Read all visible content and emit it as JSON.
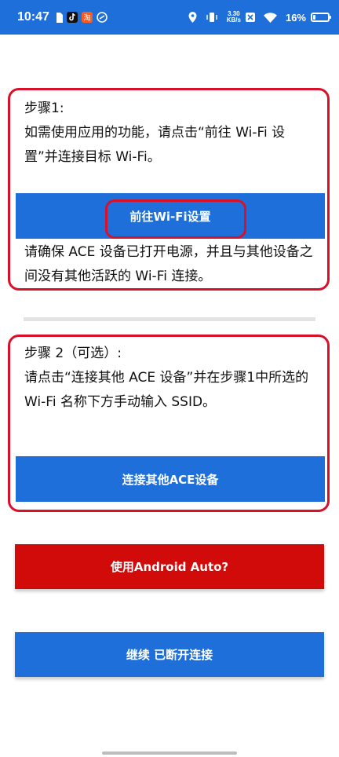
{
  "status_bar": {
    "time": "10:47",
    "net_speed_value": "3.30",
    "net_speed_unit": "KB/s",
    "battery_percent": "16%",
    "battery_level": 0.16,
    "icons": [
      "sim-card-icon",
      "tiktok-icon",
      "taobao-icon",
      "app-icon",
      "location-icon",
      "vibrate-icon",
      "data-saver-icon",
      "wifi-icon",
      "battery-icon"
    ]
  },
  "step1": {
    "title": "步骤1:",
    "instruction": "如需使用应用的功能，请点击“前往 Wi-Fi 设置”并连接目标 Wi-Fi。",
    "button_label": "前往Wi-Fi设置",
    "note": "请确保 ACE 设备已打开电源，并且与其他设备之间没有其他活跃的 Wi-Fi 连接。"
  },
  "step2": {
    "title": "步骤 2（可选）:",
    "instruction": "请点击“连接其他 ACE 设备”并在步骤1中所选的 Wi-Fi 名称下方手动输入 SSID。",
    "button_label": "连接其他ACE设备"
  },
  "actions": {
    "android_auto_label": "使用Android Auto?",
    "continue_label": "继续 已断开连接"
  },
  "colors": {
    "primary_blue": "#1e6fd9",
    "alert_red": "#d10a0a",
    "highlight_red": "#d9102a"
  }
}
